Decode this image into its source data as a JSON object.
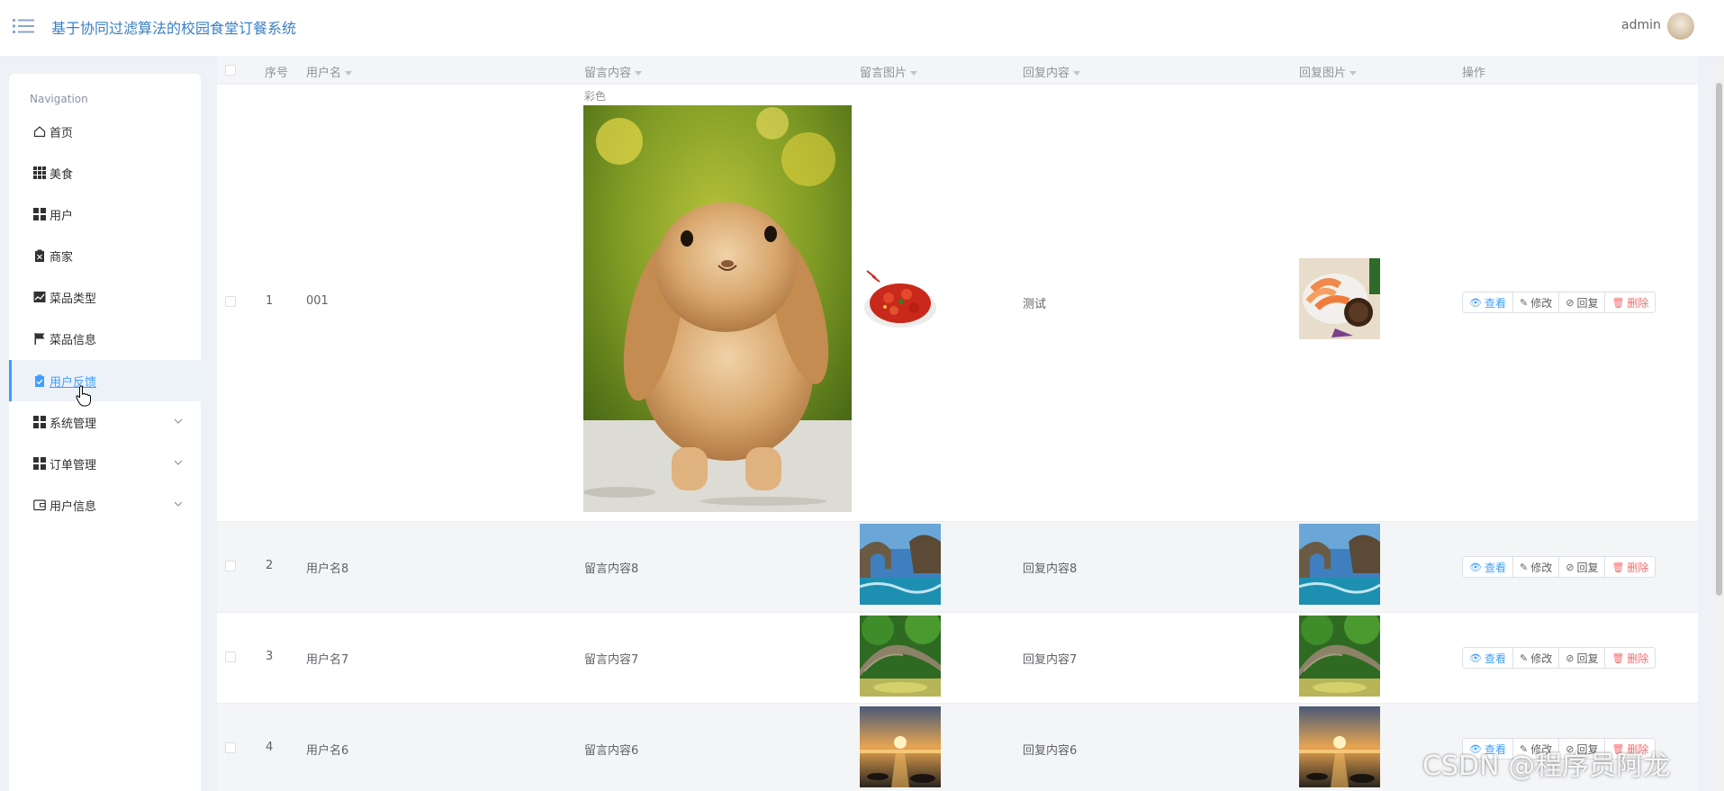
{
  "header": {
    "title": "基于协同过滤算法的校园食堂订餐系统",
    "user": "admin"
  },
  "sidebar": {
    "heading": "Navigation",
    "items": [
      {
        "label": "首页",
        "icon": "home-icon"
      },
      {
        "label": "美食",
        "icon": "grid-icon"
      },
      {
        "label": "用户",
        "icon": "grid-icon"
      },
      {
        "label": "商家",
        "icon": "clipboard-icon"
      },
      {
        "label": "菜品类型",
        "icon": "chart-icon"
      },
      {
        "label": "菜品信息",
        "icon": "flag-icon"
      },
      {
        "label": "用户反馈",
        "icon": "clipboard-check-icon",
        "active": true
      },
      {
        "label": "系统管理",
        "icon": "grid-icon",
        "expandable": true
      },
      {
        "label": "订单管理",
        "icon": "grid-icon",
        "expandable": true
      },
      {
        "label": "用户信息",
        "icon": "wallet-icon",
        "expandable": true
      }
    ]
  },
  "table": {
    "columns": [
      "序号",
      "用户名",
      "留言内容",
      "留言图片",
      "回复内容",
      "回复图片",
      "操作"
    ],
    "rows": [
      {
        "index": "1",
        "username": "001",
        "content_label": "彩色",
        "content": "",
        "reply": "测试"
      },
      {
        "index": "2",
        "username": "用户名8",
        "content": "留言内容8",
        "reply": "回复内容8"
      },
      {
        "index": "3",
        "username": "用户名7",
        "content": "留言内容7",
        "reply": "回复内容7"
      },
      {
        "index": "4",
        "username": "用户名6",
        "content": "留言内容6",
        "reply": "回复内容6"
      }
    ],
    "actions": {
      "view": "查看",
      "edit": "修改",
      "reply": "回复",
      "delete": "删除"
    }
  },
  "watermark": "CSDN @程序员阿龙",
  "colors": {
    "accent": "#409eff",
    "title": "#3a7fc4",
    "danger": "#f56c6c"
  }
}
